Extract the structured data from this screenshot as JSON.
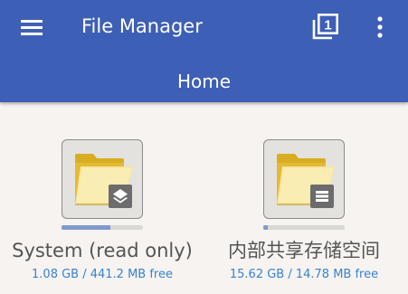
{
  "app": {
    "title": "File Manager",
    "breadcrumb": "Home",
    "theme_color": "#3d5fb5",
    "background_color": "#f6f3f0"
  },
  "toolbar": {
    "menu_icon": "hamburger-menu-icon",
    "windows_icon": "window-list-icon",
    "windows_count": "1",
    "overflow_icon": "more-vert-icon"
  },
  "storage": [
    {
      "name": "System (read only)",
      "space": "1.08 GB / 441.2 MB free",
      "badge_icon": "layers-icon",
      "usage_fraction": 0.6,
      "bar_color": "#7f9bd0"
    },
    {
      "name": "内部共享存储空间",
      "space": "15.62 GB / 14.78 MB free",
      "badge_icon": "storage-list-icon",
      "usage_fraction": 0.06,
      "bar_color": "#7f9bd0"
    }
  ]
}
